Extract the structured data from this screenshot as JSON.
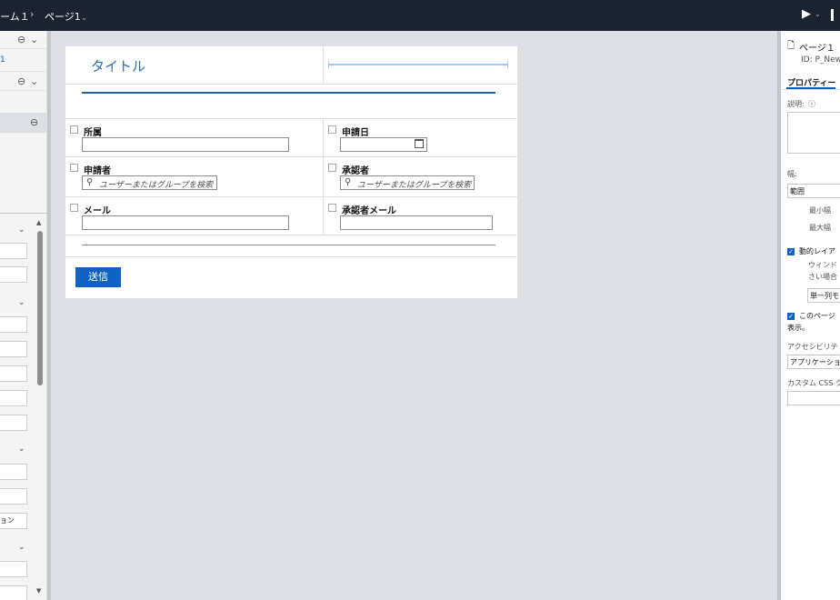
{
  "topbar": {
    "breadcrumb_form": "ーム１",
    "breadcrumb_sep": "›",
    "breadcrumb_page": "ページ1",
    "page_chevron": "⌄",
    "run_icon": "▶",
    "run_chevron": "⌄"
  },
  "left_panel": {
    "tree_link": "1",
    "fields_visible": [
      "",
      "",
      "",
      "",
      "",
      "",
      "",
      "",
      "",
      "ョン",
      "",
      ""
    ]
  },
  "form": {
    "title": "タイトル",
    "fields": {
      "affiliation": {
        "label": "所属"
      },
      "application_date": {
        "label": "申請日"
      },
      "applicant": {
        "label": "申請者",
        "placeholder": "ユーザーまたはグループを検索"
      },
      "approver": {
        "label": "承認者",
        "placeholder": "ユーザーまたはグループを検索"
      },
      "email": {
        "label": "メール"
      },
      "approver_email": {
        "label": "承認者メール"
      }
    },
    "submit_label": "送信"
  },
  "properties": {
    "page_name": "ページ１",
    "page_id": "ID: P_New",
    "tab_label": "プロパティー",
    "description_label": "説明:",
    "info_icon": "ⓘ",
    "width_label": "幅:",
    "width_value": "範囲",
    "min_width_label": "最小幅",
    "max_width_label": "最大幅",
    "dynamic_layout_label": "動的レイア",
    "dynamic_layout_desc_1": "ウィンド",
    "dynamic_layout_desc_2": "さい場合",
    "single_column_value": "単一列モ",
    "page_show_label": "このページ",
    "page_show_label_2": "表示。",
    "accessibility_label": "アクセシビリテ",
    "accessibility_value": "アプリケーション",
    "custom_css_label": "カスタム CSS ク"
  },
  "colors": {
    "topbar": "#1c2330",
    "accent": "#0f62c4",
    "title": "#2d6fb4",
    "canvas_bg": "#dde1e6"
  }
}
